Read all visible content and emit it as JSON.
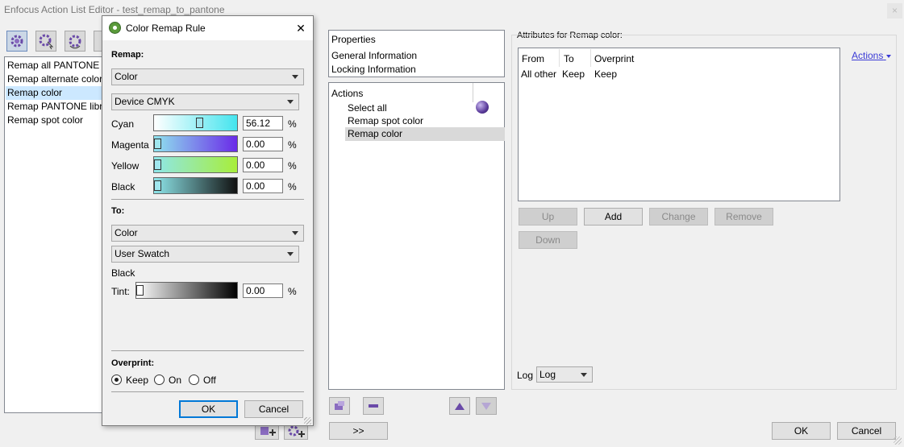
{
  "window": {
    "title": "Enfocus Action List Editor - test_remap_to_pantone",
    "close_glyph": "×"
  },
  "left_list": {
    "items": [
      "Remap all PANTONE li",
      "Remap alternate color",
      "Remap color",
      "Remap PANTONE libra",
      "Remap spot color"
    ],
    "selected_index": 2
  },
  "properties": {
    "header": "Properties",
    "items": [
      "General Information",
      "Locking Information"
    ]
  },
  "actions_panel": {
    "header": "Actions",
    "items": [
      "Select all",
      "Remap spot color",
      "Remap color"
    ],
    "selected_index": 2
  },
  "attributes": {
    "title": "Attributes for Remap color:",
    "actions_link": "Actions",
    "columns": [
      "From",
      "To",
      "Overprint"
    ],
    "rows": [
      [
        "All other",
        "Keep",
        "Keep"
      ]
    ],
    "buttons": {
      "up": "Up",
      "add": "Add",
      "change": "Change",
      "remove": "Remove",
      "down": "Down"
    }
  },
  "log": {
    "label": "Log",
    "value": "Log"
  },
  "bottom": {
    "expand": ">>",
    "ok": "OK",
    "cancel": "Cancel"
  },
  "dialog": {
    "title": "Color Remap Rule",
    "close_glyph": "✕",
    "remap_label": "Remap:",
    "remap_type": "Color",
    "remap_space": "Device CMYK",
    "channels": [
      {
        "name": "Cyan",
        "value": "56.12",
        "level_percent": 56.12,
        "unit": "%"
      },
      {
        "name": "Magenta",
        "value": "0.00",
        "level_percent": 0,
        "unit": "%"
      },
      {
        "name": "Yellow",
        "value": "0.00",
        "level_percent": 0,
        "unit": "%"
      },
      {
        "name": "Black",
        "value": "0.00",
        "level_percent": 0,
        "unit": "%"
      }
    ],
    "to_label": "To:",
    "to_type": "Color",
    "to_space": "User Swatch",
    "swatch_name": "Black",
    "tint": {
      "name": "Tint:",
      "value": "0.00",
      "level_percent": 0,
      "unit": "%"
    },
    "overprint_label": "Overprint:",
    "overprint_options": [
      "Keep",
      "On",
      "Off"
    ],
    "overprint_selected": "Keep",
    "ok": "OK",
    "cancel": "Cancel"
  },
  "colors": {
    "accent": "#0078d7",
    "link": "#3a3ad6",
    "selection": "#cce8ff",
    "icon_purple": "#6a4aa8"
  }
}
